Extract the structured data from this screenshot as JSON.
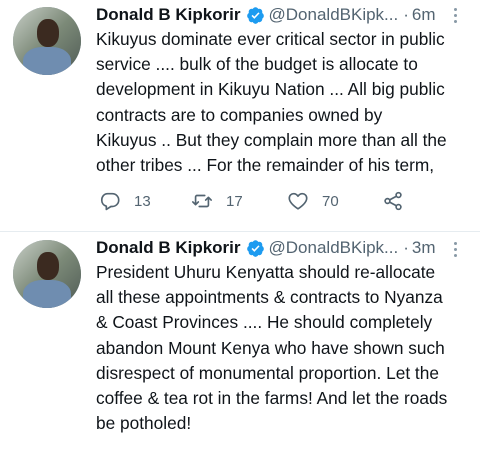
{
  "tweets": [
    {
      "author_name": "Donald B Kipkorir",
      "handle": "@DonaldBKipk...",
      "separator": "·",
      "time": "6m",
      "text": "Kikuyus dominate ever critical sector in public\nservice .... bulk of the budget is allocate to\ndevelopment in Kikuyu Nation ... All big public\ncontracts are to companies owned by\nKikuyus .. But they complain more than all the\nother tribes ... For the remainder of his term,",
      "replies": "13",
      "retweets": "17",
      "likes": "70"
    },
    {
      "author_name": "Donald B Kipkorir",
      "handle": "@DonaldBKipk...",
      "separator": "·",
      "time": "3m",
      "text": "President Uhuru Kenyatta should re-allocate\nall these appointments & contracts to Nyanza\n& Coast Provinces .... He should completely\nabandon Mount Kenya who have shown such\ndisrespect of monumental proportion. Let the\ncoffee & tea rot in the farms! And let the roads\nbe potholed!"
    }
  ],
  "colors": {
    "verified_badge": "#1d9bf0",
    "secondary_text": "#536471",
    "divider": "#e6ecf0"
  },
  "icons": {
    "verified": "verified-badge-icon",
    "more": "more-vertical-icon",
    "reply": "reply-icon",
    "retweet": "retweet-icon",
    "like": "heart-icon",
    "share": "share-icon"
  }
}
